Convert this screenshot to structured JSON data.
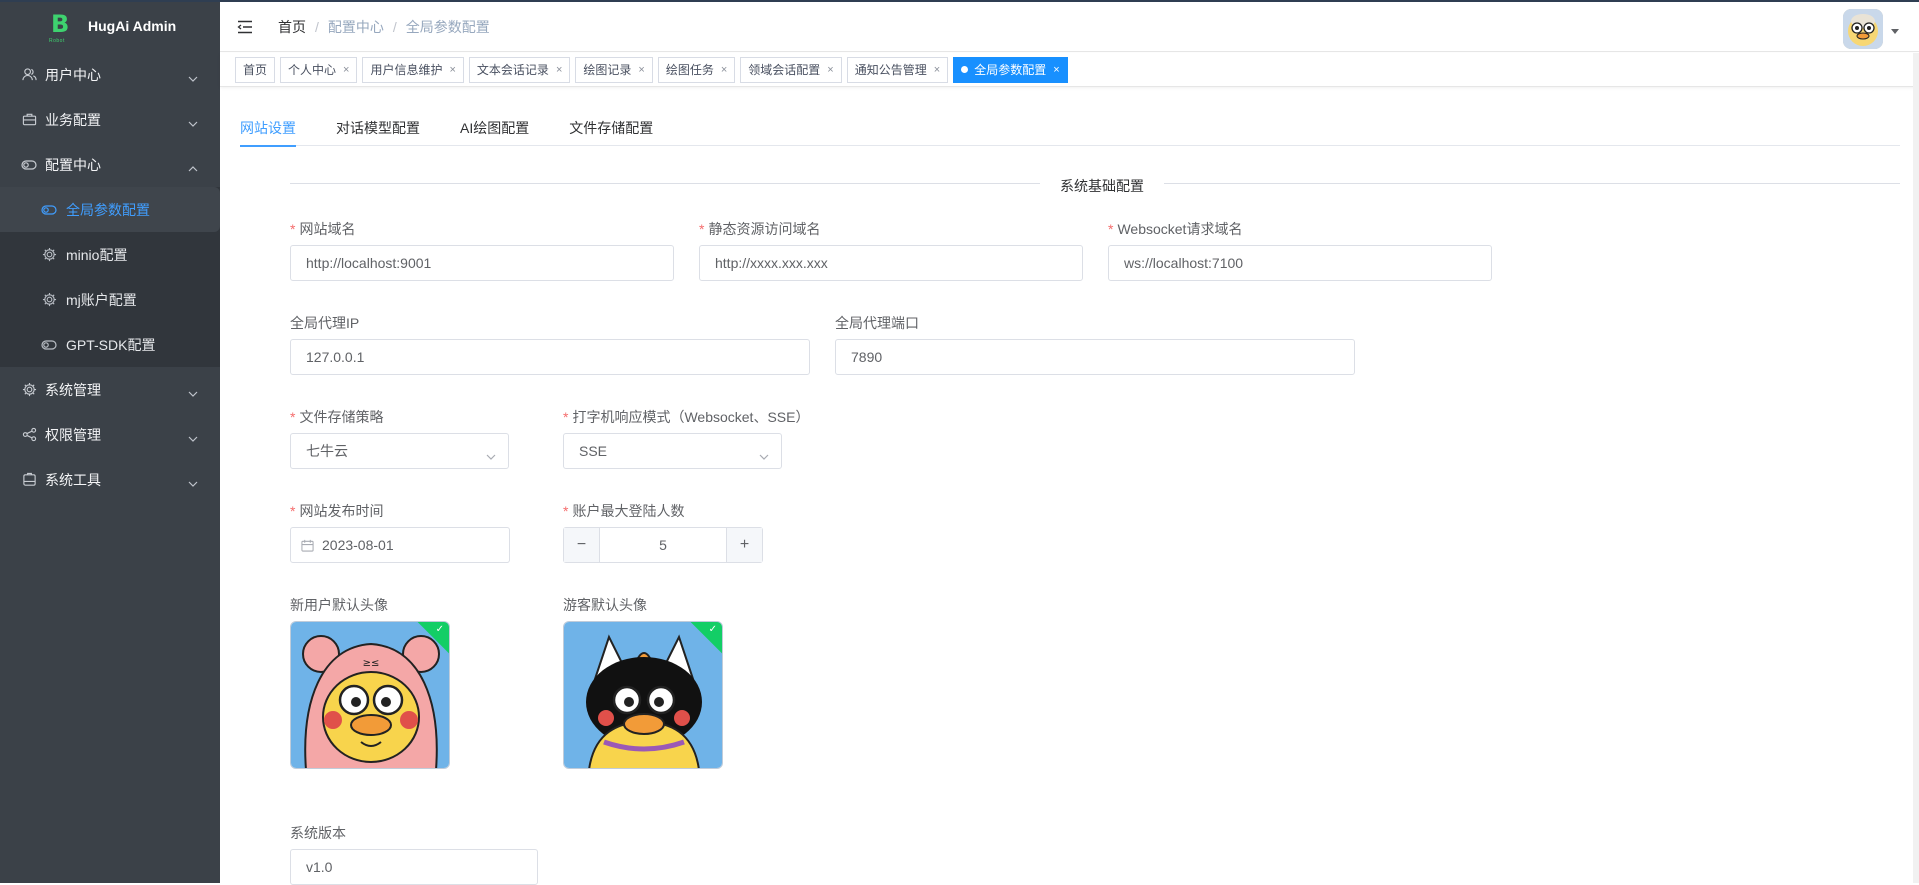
{
  "app": {
    "title": "HugAi Admin",
    "logo_letter": "B",
    "logo_sub": "Robot"
  },
  "sidebar": {
    "items": [
      {
        "label": "用户中心",
        "icon": "user-icon"
      },
      {
        "label": "业务配置",
        "icon": "briefcase-icon"
      },
      {
        "label": "配置中心",
        "icon": "toggle-icon",
        "expanded": true,
        "children": [
          {
            "label": "全局参数配置",
            "icon": "toggle-icon",
            "active": true
          },
          {
            "label": "minio配置",
            "icon": "gear-icon"
          },
          {
            "label": "mj账户配置",
            "icon": "gear-icon"
          },
          {
            "label": "GPT-SDK配置",
            "icon": "toggle-icon"
          }
        ]
      },
      {
        "label": "系统管理",
        "icon": "gear-icon"
      },
      {
        "label": "权限管理",
        "icon": "share-icon"
      },
      {
        "label": "系统工具",
        "icon": "box-icon"
      }
    ]
  },
  "breadcrumb": [
    "首页",
    "配置中心",
    "全局参数配置"
  ],
  "tags": [
    {
      "label": "首页",
      "closable": false
    },
    {
      "label": "个人中心",
      "closable": true
    },
    {
      "label": "用户信息维护",
      "closable": true
    },
    {
      "label": "文本会话记录",
      "closable": true
    },
    {
      "label": "绘图记录",
      "closable": true
    },
    {
      "label": "绘图任务",
      "closable": true
    },
    {
      "label": "领域会话配置",
      "closable": true
    },
    {
      "label": "通知公告管理",
      "closable": true
    },
    {
      "label": "全局参数配置",
      "closable": true,
      "active": true
    }
  ],
  "tabs": [
    "网站设置",
    "对话模型配置",
    "AI绘图配置",
    "文件存储配置"
  ],
  "form": {
    "section_title": "系统基础配置",
    "site_domain": {
      "label": "网站域名",
      "value": "http://localhost:9001"
    },
    "static_domain": {
      "label": "静态资源访问域名",
      "value": "http://xxxx.xxx.xxx"
    },
    "ws_domain": {
      "label": "Websocket请求域名",
      "value": "ws://localhost:7100"
    },
    "proxy_ip": {
      "label": "全局代理IP",
      "value": "127.0.0.1"
    },
    "proxy_port": {
      "label": "全局代理端口",
      "value": "7890"
    },
    "storage_policy": {
      "label": "文件存储策略",
      "value": "七牛云"
    },
    "typing_mode": {
      "label": "打字机响应模式（Websocket、SSE）",
      "value": "SSE"
    },
    "publish_date": {
      "label": "网站发布时间",
      "value": "2023-08-01"
    },
    "max_logins": {
      "label": "账户最大登陆人数",
      "value": "5"
    },
    "default_avatar": {
      "label": "新用户默认头像"
    },
    "guest_avatar": {
      "label": "游客默认头像"
    },
    "version": {
      "label": "系统版本",
      "value": "v1.0"
    }
  },
  "colors": {
    "sidebar_bg": "#3b4148",
    "accent": "#409eff",
    "active_tag": "#1890ff",
    "success": "#13ce66",
    "required": "#f56c6c"
  }
}
